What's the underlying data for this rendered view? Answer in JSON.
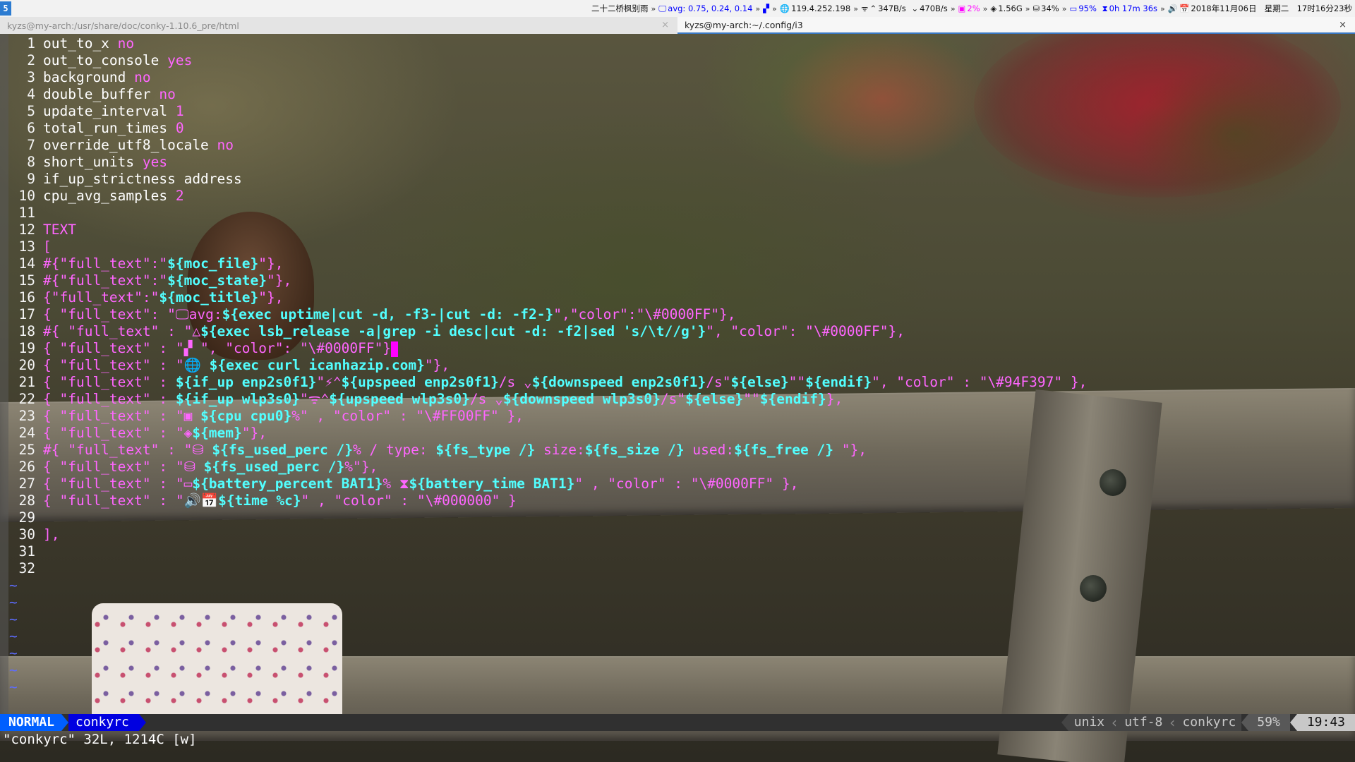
{
  "topbar": {
    "workspace": "5",
    "music": "二十二桥枫别雨",
    "load": "avg: 0.75, 0.24, 0.14",
    "ip": "119.4.252.198",
    "up": "347B/s",
    "down": "470B/s",
    "cpu": "2%",
    "mem": "1.56G",
    "disk": "34%",
    "battery": "95%",
    "battery_time": "0h 17m 36s",
    "date": "2018年11月06日",
    "weekday": "星期二",
    "time": "17时16分23秒",
    "sep": "»"
  },
  "tabs": [
    {
      "title": "kyzs@my-arch:/usr/share/doc/conky-1.10.6_pre/html",
      "close": "×"
    },
    {
      "title": "kyzs@my-arch:~/.config/i3",
      "close": "×"
    }
  ],
  "icons": {
    "monitor": "🖵",
    "distro": "△",
    "windows": "▞",
    "globe": "🌐",
    "wifi": "ᯤ",
    "up": "⌃",
    "down": "⌄",
    "cpu": "▣",
    "mem": "◈",
    "disk": "⛁",
    "battery": "▭",
    "hourglass": "⧗",
    "speaker": "🔊",
    "calendar": "📅",
    "plug": "⚡"
  },
  "editor": {
    "tilde": "~",
    "lines": [
      {
        "n": "1",
        "t": [
          [
            "k",
            "out_to_x "
          ],
          [
            "v",
            "no"
          ]
        ]
      },
      {
        "n": "2",
        "t": [
          [
            "k",
            "out_to_console "
          ],
          [
            "v",
            "yes"
          ]
        ]
      },
      {
        "n": "3",
        "t": [
          [
            "k",
            "background "
          ],
          [
            "v",
            "no"
          ]
        ]
      },
      {
        "n": "4",
        "t": [
          [
            "k",
            "double_buffer "
          ],
          [
            "v",
            "no"
          ]
        ]
      },
      {
        "n": "5",
        "t": [
          [
            "k",
            "update_interval "
          ],
          [
            "v",
            "1"
          ]
        ]
      },
      {
        "n": "6",
        "t": [
          [
            "k",
            "total_run_times "
          ],
          [
            "v",
            "0"
          ]
        ]
      },
      {
        "n": "7",
        "t": [
          [
            "k",
            "override_utf8_locale "
          ],
          [
            "v",
            "no"
          ]
        ]
      },
      {
        "n": "8",
        "t": [
          [
            "k",
            "short_units "
          ],
          [
            "v",
            "yes"
          ]
        ]
      },
      {
        "n": "9",
        "t": [
          [
            "k",
            "if_up_strictness address"
          ]
        ]
      },
      {
        "n": "10",
        "t": [
          [
            "k",
            "cpu_avg_samples "
          ],
          [
            "v",
            "2"
          ]
        ]
      },
      {
        "n": "11",
        "t": []
      },
      {
        "n": "12",
        "t": [
          [
            "v",
            "TEXT"
          ]
        ]
      },
      {
        "n": "13",
        "t": [
          [
            "v",
            "["
          ]
        ]
      },
      {
        "n": "14",
        "t": [
          [
            "v",
            "#{\"full_text\":\""
          ],
          [
            "cb",
            "${moc_file}"
          ],
          [
            "v",
            "\"},"
          ]
        ]
      },
      {
        "n": "15",
        "t": [
          [
            "v",
            "#{\"full_text\":\""
          ],
          [
            "cb",
            "${moc_state}"
          ],
          [
            "v",
            "\"},"
          ]
        ]
      },
      {
        "n": "16",
        "t": [
          [
            "v",
            "{\"full_text\":\""
          ],
          [
            "cb",
            "${moc_title}"
          ],
          [
            "v",
            "\"},"
          ]
        ]
      },
      {
        "n": "17",
        "t": [
          [
            "v",
            "{ \"full_text\": \"🖵avg:"
          ],
          [
            "cb",
            "${exec uptime|cut -d, -f3-|cut -d: -f2-}"
          ],
          [
            "v",
            "\",\"color\":\"\\#0000FF\"},"
          ]
        ]
      },
      {
        "n": "18",
        "t": [
          [
            "v",
            "#{ \"full_text\" : \"△"
          ],
          [
            "cb",
            "${exec lsb_release -a|grep -i desc|cut -d: -f2|sed 's/\\t//g'}"
          ],
          [
            "v",
            "\", \"color\": \"\\#0000FF\"},"
          ]
        ]
      },
      {
        "n": "19",
        "t": [
          [
            "v",
            "{ \"full_text\" : \"▞ \", \"color\": \"\\#0000FF\"}"
          ],
          [
            "cursor",
            ","
          ]
        ]
      },
      {
        "n": "20",
        "t": [
          [
            "v",
            "{ \"full_text\" : \"🌐 "
          ],
          [
            "cb",
            "${exec curl icanhazip.com}"
          ],
          [
            "v",
            "\"},"
          ]
        ]
      },
      {
        "n": "21",
        "t": [
          [
            "v",
            "{ \"full_text\" : "
          ],
          [
            "cb",
            "${if_up enp2s0f1}"
          ],
          [
            "v",
            "\"⚡⌃"
          ],
          [
            "cb",
            "${upspeed enp2s0f1}"
          ],
          [
            "v",
            "/s ⌄"
          ],
          [
            "cb",
            "${downspeed enp2s0f1}"
          ],
          [
            "v",
            "/s\""
          ],
          [
            "cb",
            "${else}"
          ],
          [
            "v",
            "\"\""
          ],
          [
            "cb",
            "${endif}"
          ],
          [
            "v",
            "\", \"color\" : \"\\#94F397\" },"
          ]
        ]
      },
      {
        "n": "22",
        "t": [
          [
            "v",
            "{ \"full_text\" : "
          ],
          [
            "cb",
            "${if_up wlp3s0}"
          ],
          [
            "v",
            "\"ᯤ⌃"
          ],
          [
            "cb",
            "${upspeed wlp3s0}"
          ],
          [
            "v",
            "/s ⌄"
          ],
          [
            "cb",
            "${downspeed wlp3s0}"
          ],
          [
            "v",
            "/s\""
          ],
          [
            "cb",
            "${else}"
          ],
          [
            "v",
            "\"\""
          ],
          [
            "cb",
            "${endif}"
          ],
          [
            "v",
            "},"
          ]
        ]
      },
      {
        "n": "23",
        "t": [
          [
            "v",
            "{ \"full_text\" : \"▣ "
          ],
          [
            "cb",
            "${cpu cpu0}"
          ],
          [
            "v",
            "%\" , \"color\" : \"\\#FF00FF\" },"
          ]
        ]
      },
      {
        "n": "24",
        "t": [
          [
            "v",
            "{ \"full_text\" : \"◈"
          ],
          [
            "cb",
            "${mem}"
          ],
          [
            "v",
            "\"},"
          ]
        ]
      },
      {
        "n": "25",
        "t": [
          [
            "v",
            "#{ \"full_text\" : \"⛁ "
          ],
          [
            "cb",
            "${fs_used_perc /}"
          ],
          [
            "v",
            "% / type: "
          ],
          [
            "cb",
            "${fs_type /}"
          ],
          [
            "v",
            " size:"
          ],
          [
            "cb",
            "${fs_size /}"
          ],
          [
            "v",
            " used:"
          ],
          [
            "cb",
            "${fs_free /}"
          ],
          [
            "v",
            " \"},"
          ]
        ]
      },
      {
        "n": "26",
        "t": [
          [
            "v",
            "{ \"full_text\" : \"⛁ "
          ],
          [
            "cb",
            "${fs_used_perc /}"
          ],
          [
            "v",
            "%\"},"
          ]
        ]
      },
      {
        "n": "27",
        "t": [
          [
            "v",
            "{ \"full_text\" : \"▭"
          ],
          [
            "cb",
            "${battery_percent BAT1}"
          ],
          [
            "v",
            "% ⧗"
          ],
          [
            "cb",
            "${battery_time BAT1}"
          ],
          [
            "v",
            "\" , \"color\" : \"\\#0000FF\" },"
          ]
        ]
      },
      {
        "n": "28",
        "t": [
          [
            "v",
            "{ \"full_text\" : \"🔊📅"
          ],
          [
            "cb",
            "${time %c}"
          ],
          [
            "v",
            "\" , \"color\" : \"\\#000000\" }"
          ]
        ]
      },
      {
        "n": "29",
        "t": []
      },
      {
        "n": "30",
        "t": [
          [
            "v",
            "],"
          ]
        ]
      },
      {
        "n": "31",
        "t": []
      },
      {
        "n": "32",
        "t": []
      }
    ],
    "tilde_count": 7
  },
  "statusline": {
    "mode": "NORMAL",
    "filename": "conkyrc",
    "fileformat": "unix",
    "encoding": "utf-8",
    "filetype": "conkyrc",
    "percent": "59%",
    "position": "19:43"
  },
  "cmdline": "\"conkyrc\" 32L, 1214C [w]"
}
